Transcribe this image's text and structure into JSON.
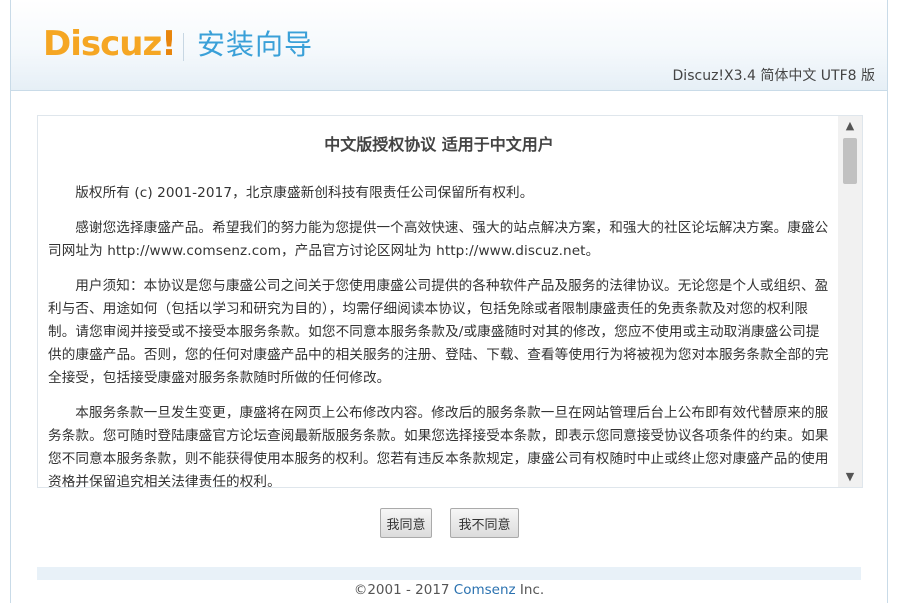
{
  "header": {
    "logo_text": "Discuz",
    "logo_mark": "!",
    "wizard_title": "安装向导",
    "version": "Discuz!X3.4 简体中文 UTF8 版"
  },
  "license": {
    "title": "中文版授权协议 适用于中文用户",
    "paragraphs": [
      "版权所有 (c) 2001-2017，北京康盛新创科技有限责任公司保留所有权利。",
      "感谢您选择康盛产品。希望我们的努力能为您提供一个高效快速、强大的站点解决方案，和强大的社区论坛解决方案。康盛公司网址为 http://www.comsenz.com，产品官方讨论区网址为 http://www.discuz.net。",
      "用户须知：本协议是您与康盛公司之间关于您使用康盛公司提供的各种软件产品及服务的法律协议。无论您是个人或组织、盈利与否、用途如何（包括以学习和研究为目的），均需仔细阅读本协议，包括免除或者限制康盛责任的免责条款及对您的权利限制。请您审阅并接受或不接受本服务条款。如您不同意本服务条款及/或康盛随时对其的修改，您应不使用或主动取消康盛公司提供的康盛产品。否则，您的任何对康盛产品中的相关服务的注册、登陆、下载、查看等使用行为将被视为您对本服务条款全部的完全接受，包括接受康盛对服务条款随时所做的任何修改。",
      "本服务条款一旦发生变更，康盛将在网页上公布修改内容。修改后的服务条款一旦在网站管理后台上公布即有效代替原来的服务条款。您可随时登陆康盛官方论坛查阅最新版服务条款。如果您选择接受本条款，即表示您同意接受协议各项条件的约束。如果您不同意本服务条款，则不能获得使用本服务的权利。您若有违反本条款规定，康盛公司有权随时中止或终止您对康盛产品的使用资格并保留追究相关法律责任的权利。"
    ]
  },
  "buttons": {
    "agree": "我同意",
    "disagree": "我不同意"
  },
  "footer": {
    "prefix": "©2001 - 2017 ",
    "brand": "Comsenz",
    "suffix": " Inc."
  }
}
